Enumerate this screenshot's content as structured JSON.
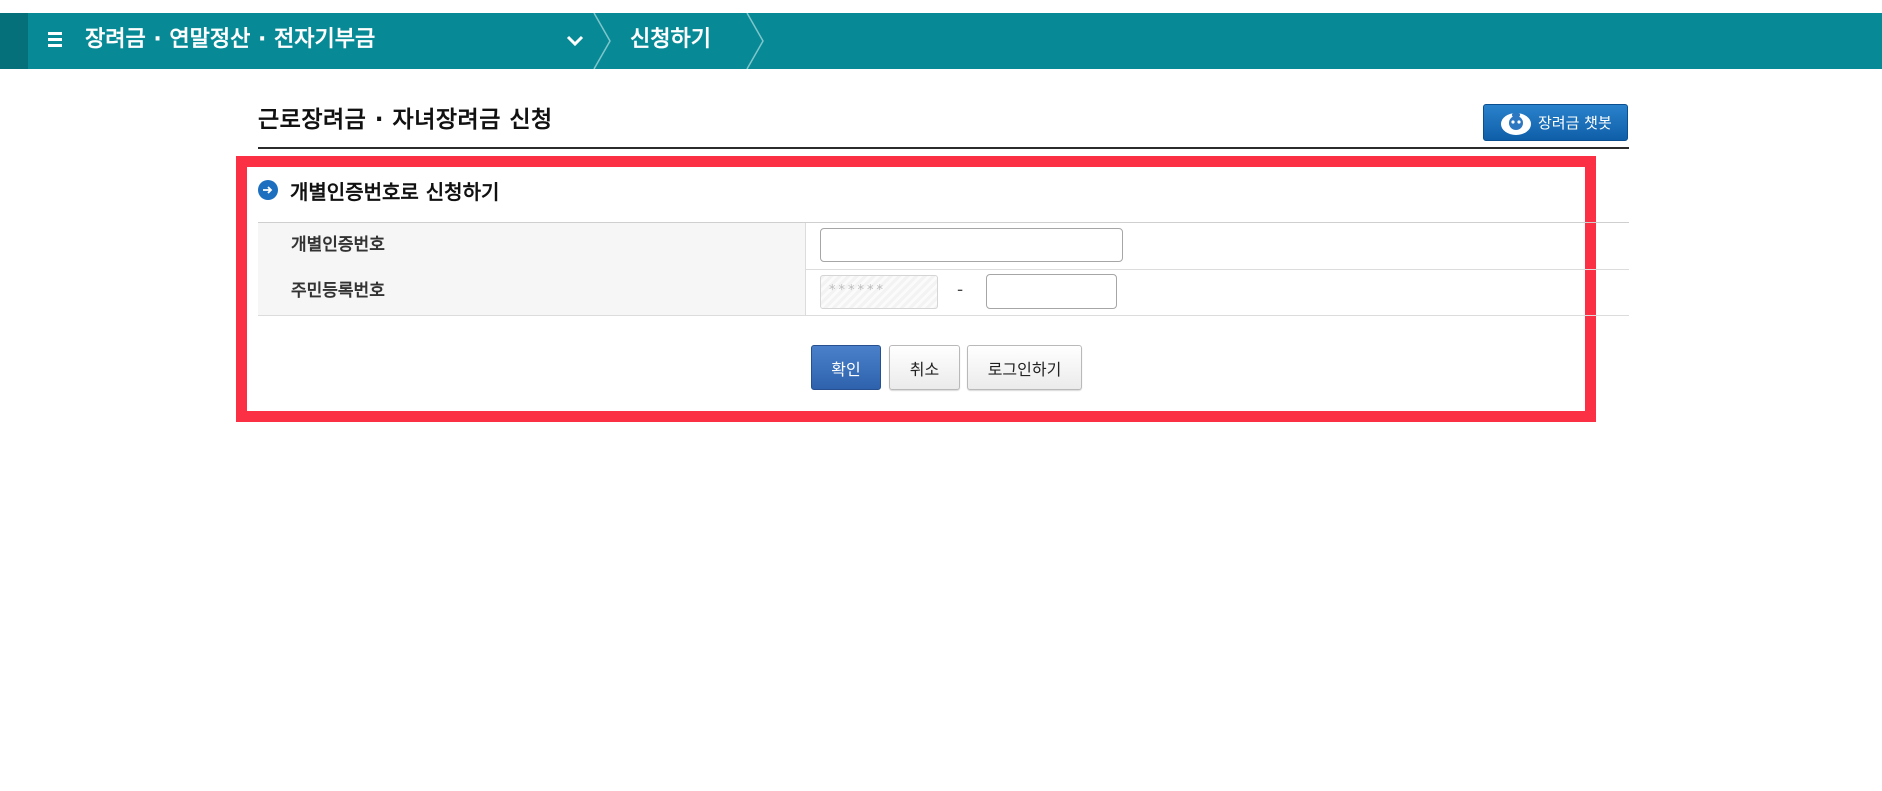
{
  "topbar": {
    "menu_title": "장려금 · 연말정산 · 전자기부금",
    "current_crumb": "신청하기",
    "bar_color": "#078a96"
  },
  "page": {
    "title": "근로장려금 · 자녀장려금 신청",
    "chatbot_label": "장려금 챗봇"
  },
  "form": {
    "section_title": "개별인증번호로 신청하기",
    "rows": [
      {
        "label": "개별인증번호",
        "value": ""
      },
      {
        "label": "주민등록번호",
        "front_masked": "******",
        "back_value": ""
      }
    ],
    "dash": "-"
  },
  "actions": {
    "confirm": "확인",
    "cancel": "취소",
    "login": "로그인하기"
  },
  "colors": {
    "highlight": "#fc3044",
    "primary_button": "#2e62ad",
    "chatbot_button": "#1a6fba"
  },
  "icons": [
    "menu-icon",
    "chevron-down-icon",
    "chatbot-icon",
    "arrow-circle-icon"
  ]
}
